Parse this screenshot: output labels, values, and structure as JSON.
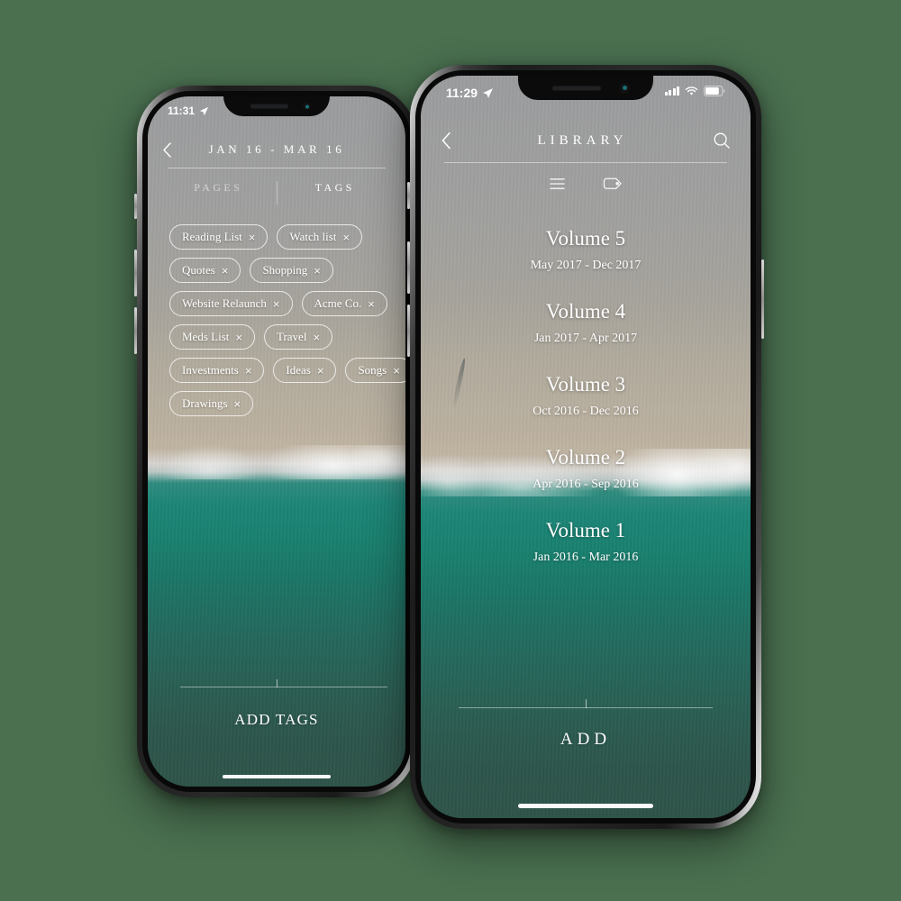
{
  "theme": {
    "canvas_background": "#4a7050",
    "water_teal": "#1c8577",
    "water_deep": "#2e5349",
    "sand": "#a6a39c",
    "text_on_photo": "#ffffff"
  },
  "back_phone": {
    "status_bar": {
      "time": "11:31",
      "location_icon": "location-arrow-icon"
    },
    "nav": {
      "back_icon": "chevron-left-icon",
      "title": "JAN 16  -  MAR 16"
    },
    "tabs": [
      {
        "label": "PAGES",
        "active": false
      },
      {
        "label": "TAGS",
        "active": true
      }
    ],
    "tags": [
      {
        "label": "Reading List",
        "remove_icon": "close-icon"
      },
      {
        "label": "Watch list",
        "remove_icon": "close-icon"
      },
      {
        "label": "Quotes",
        "remove_icon": "close-icon"
      },
      {
        "label": "Shopping",
        "remove_icon": "close-icon"
      },
      {
        "label": "Website Relaunch",
        "remove_icon": "close-icon"
      },
      {
        "label": "Acme Co.",
        "remove_icon": "close-icon"
      },
      {
        "label": "Meds List",
        "remove_icon": "close-icon"
      },
      {
        "label": "Travel",
        "remove_icon": "close-icon"
      },
      {
        "label": "Investments",
        "remove_icon": "close-icon"
      },
      {
        "label": "Ideas",
        "remove_icon": "close-icon"
      },
      {
        "label": "Songs",
        "remove_icon": "close-icon"
      },
      {
        "label": "Drawings",
        "remove_icon": "close-icon"
      }
    ],
    "action": {
      "label": "ADD TAGS"
    }
  },
  "front_phone": {
    "status_bar": {
      "time": "11:29",
      "location_icon": "location-arrow-icon",
      "signal_icon": "cellular-signal-icon",
      "wifi_icon": "wifi-icon",
      "battery_icon": "battery-icon"
    },
    "nav": {
      "back_icon": "chevron-left-icon",
      "title": "LIBRARY",
      "search_icon": "search-icon"
    },
    "toolbar": [
      {
        "icon": "list-view-icon",
        "active": true
      },
      {
        "icon": "tag-icon",
        "active": false
      }
    ],
    "volumes": [
      {
        "title": "Volume 5",
        "range": "May 2017 - Dec 2017"
      },
      {
        "title": "Volume 4",
        "range": "Jan 2017 - Apr 2017"
      },
      {
        "title": "Volume 3",
        "range": "Oct 2016 - Dec 2016"
      },
      {
        "title": "Volume 2",
        "range": "Apr 2016 - Sep 2016"
      },
      {
        "title": "Volume 1",
        "range": "Jan 2016 - Mar 2016"
      }
    ],
    "action": {
      "label": "ADD"
    }
  }
}
